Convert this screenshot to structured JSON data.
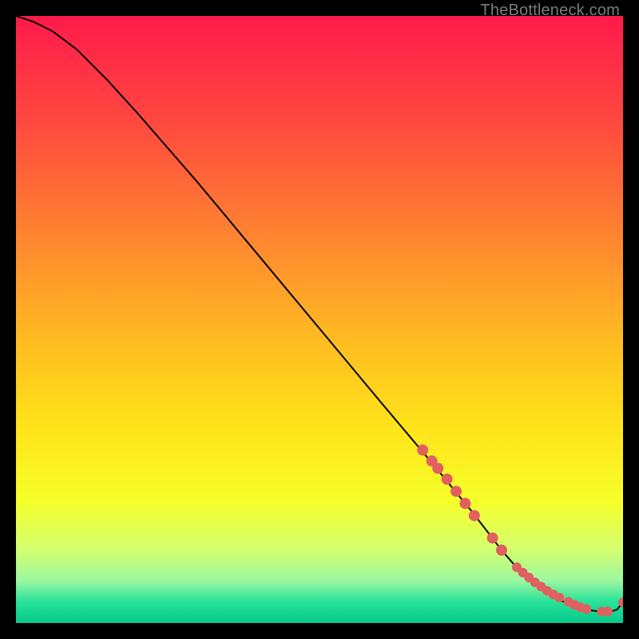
{
  "watermark": "TheBottleneck.com",
  "chart_data": {
    "type": "line",
    "title": "",
    "xlabel": "",
    "ylabel": "",
    "xlim": [
      0,
      100
    ],
    "ylim": [
      0,
      100
    ],
    "grid": false,
    "legend": false,
    "background_gradient": {
      "stops": [
        {
          "offset": 0.0,
          "color": "#ff1a4b"
        },
        {
          "offset": 0.18,
          "color": "#ff4a3f"
        },
        {
          "offset": 0.38,
          "color": "#ff8a2f"
        },
        {
          "offset": 0.55,
          "color": "#ffc020"
        },
        {
          "offset": 0.68,
          "color": "#ffe41a"
        },
        {
          "offset": 0.8,
          "color": "#f6ff2a"
        },
        {
          "offset": 0.88,
          "color": "#d3ff70"
        },
        {
          "offset": 0.93,
          "color": "#9cf7a0"
        },
        {
          "offset": 0.965,
          "color": "#28e29a"
        },
        {
          "offset": 1.0,
          "color": "#05c98a"
        }
      ]
    },
    "series": [
      {
        "name": "curve",
        "color": "#000000",
        "x": [
          0,
          3,
          6,
          10,
          15,
          20,
          30,
          40,
          50,
          60,
          68,
          75,
          80,
          82,
          84,
          86,
          88,
          90,
          92,
          94,
          96,
          98,
          99,
          100
        ],
        "y": [
          100,
          99,
          97.5,
          94.5,
          89.5,
          84,
          72.5,
          60.5,
          48.5,
          36.5,
          27,
          18.5,
          12,
          9.7,
          7.8,
          6.1,
          4.7,
          3.6,
          2.8,
          2.2,
          1.9,
          1.9,
          2.2,
          3.4
        ]
      }
    ],
    "markers": {
      "name": "points",
      "color": "#e06060",
      "radius_large": 7,
      "radius_small": 6,
      "x": [
        67,
        68.5,
        69.5,
        71,
        72.5,
        74,
        75.5,
        78.5,
        80,
        82.5,
        83.5,
        84.5,
        85.5,
        86.5,
        87.5,
        88.5,
        89.5,
        91,
        92,
        93,
        94,
        96.5,
        97.5,
        100
      ],
      "y": [
        28.5,
        26.7,
        25.5,
        23.7,
        21.7,
        19.7,
        17.7,
        14.0,
        12.0,
        9.2,
        8.3,
        7.5,
        6.7,
        6.0,
        5.3,
        4.7,
        4.2,
        3.5,
        3.0,
        2.6,
        2.3,
        1.9,
        1.9,
        3.4
      ]
    }
  }
}
